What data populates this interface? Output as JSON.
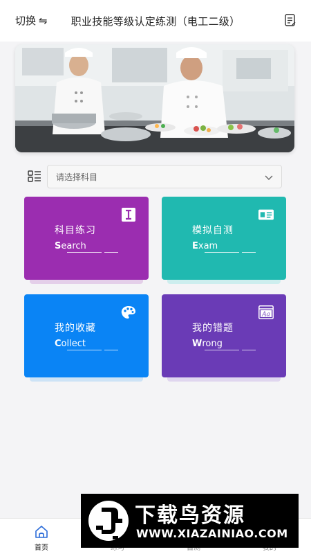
{
  "header": {
    "switch_label": "切换",
    "switch_arrows": "⇋",
    "title": "职业技能等级认定练测（电工二级）"
  },
  "selector": {
    "placeholder": "请选择科目"
  },
  "cards": [
    {
      "cn": "科目练习",
      "en_first": "S",
      "en_rest": "earch",
      "color": "#9b2db0",
      "shadow": "#e4cfe9",
      "icon": "text-cursor-icon"
    },
    {
      "cn": "模拟自测",
      "en_first": "E",
      "en_rest": "xam",
      "color": "#20b9b0",
      "shadow": "#cdeeee",
      "icon": "id-card-icon"
    },
    {
      "cn": "我的收藏",
      "en_first": "C",
      "en_rest": "ollect",
      "color": "#0a84f5",
      "shadow": "#cde3f6",
      "icon": "palette-icon"
    },
    {
      "cn": "我的错题",
      "en_first": "W",
      "en_rest": "rong",
      "color": "#6a3bb6",
      "shadow": "#e0d6ef",
      "icon": "font-window-icon"
    }
  ],
  "tabs": [
    {
      "label": "首页",
      "icon": "home-icon",
      "active": true
    },
    {
      "label": "练习",
      "icon": "practice-icon",
      "active": false
    },
    {
      "label": "自测",
      "icon": "test-icon",
      "active": false
    },
    {
      "label": "我的",
      "icon": "user-icon",
      "active": false
    }
  ],
  "watermark": {
    "title": "下载鸟资源",
    "url": "WWW.XIAZAINIAO.COM"
  }
}
